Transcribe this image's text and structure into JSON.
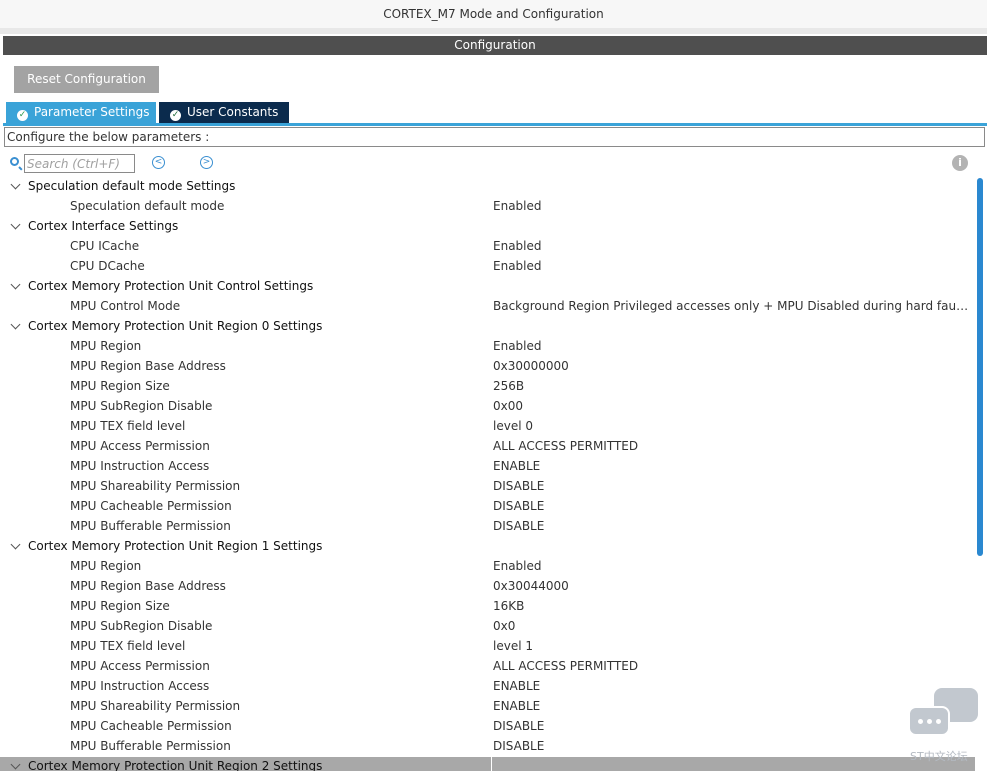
{
  "window": {
    "title": "CORTEX_M7 Mode and Configuration"
  },
  "config_header": "Configuration",
  "reset_button": "Reset Configuration",
  "tabs": [
    {
      "label": "Parameter Settings",
      "active": true
    },
    {
      "label": "User Constants",
      "active": false
    }
  ],
  "configure_text": "Configure the below parameters :",
  "search": {
    "placeholder": "Search (Ctrl+F)",
    "value": ""
  },
  "colors": {
    "accent": "#3aa3d8",
    "header_bg": "#4f4f4f",
    "tab_dark": "#0b2b4d",
    "scroll": "#2a88d0"
  },
  "tree": {
    "groups": [
      {
        "label": "Speculation default mode Settings",
        "params": [
          {
            "label": "Speculation default mode",
            "value": "Enabled"
          }
        ]
      },
      {
        "label": "Cortex Interface Settings",
        "params": [
          {
            "label": "CPU ICache",
            "value": "Enabled"
          },
          {
            "label": "CPU DCache",
            "value": "Enabled"
          }
        ]
      },
      {
        "label": "Cortex Memory Protection Unit Control Settings",
        "params": [
          {
            "label": "MPU Control Mode",
            "value": "Background Region Privileged accesses only + MPU Disabled during hard fault, ..."
          }
        ]
      },
      {
        "label": "Cortex Memory Protection Unit Region 0 Settings",
        "params": [
          {
            "label": "MPU Region",
            "value": "Enabled"
          },
          {
            "label": "MPU Region Base Address",
            "value": "0x30000000"
          },
          {
            "label": "MPU Region Size",
            "value": "256B"
          },
          {
            "label": "MPU SubRegion Disable",
            "value": "0x00"
          },
          {
            "label": "MPU TEX field level",
            "value": "level 0"
          },
          {
            "label": "MPU Access Permission",
            "value": "ALL ACCESS PERMITTED"
          },
          {
            "label": "MPU Instruction Access",
            "value": "ENABLE"
          },
          {
            "label": "MPU Shareability Permission",
            "value": "DISABLE"
          },
          {
            "label": "MPU Cacheable Permission",
            "value": "DISABLE"
          },
          {
            "label": "MPU Bufferable  Permission",
            "value": "DISABLE"
          }
        ]
      },
      {
        "label": "Cortex Memory Protection Unit Region 1 Settings",
        "params": [
          {
            "label": "MPU Region",
            "value": "Enabled"
          },
          {
            "label": "MPU Region Base Address",
            "value": "0x30044000"
          },
          {
            "label": "MPU Region Size",
            "value": "16KB"
          },
          {
            "label": "MPU SubRegion Disable",
            "value": "0x0"
          },
          {
            "label": "MPU TEX field level",
            "value": "level 1"
          },
          {
            "label": "MPU Access Permission",
            "value": "ALL ACCESS PERMITTED"
          },
          {
            "label": "MPU Instruction Access",
            "value": "ENABLE"
          },
          {
            "label": "MPU Shareability Permission",
            "value": "ENABLE"
          },
          {
            "label": "MPU Cacheable Permission",
            "value": "DISABLE"
          },
          {
            "label": "MPU Bufferable  Permission",
            "value": "DISABLE"
          }
        ]
      },
      {
        "label": "Cortex Memory Protection Unit Region 2 Settings",
        "params": [],
        "highlighted": true
      }
    ]
  },
  "watermark": {
    "text": "ST中文论坛"
  }
}
